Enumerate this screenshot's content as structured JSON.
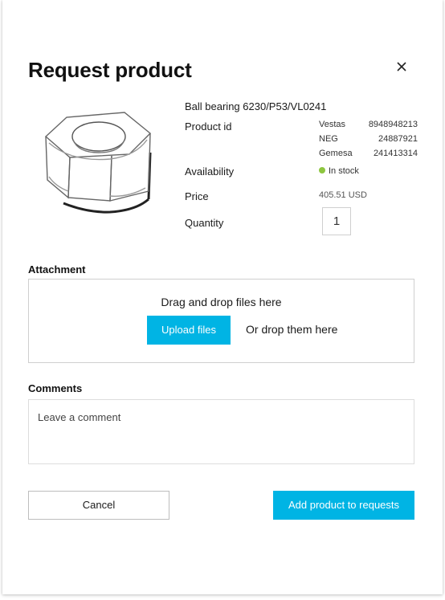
{
  "dialog": {
    "title": "Request product",
    "close_icon": "close-icon"
  },
  "product": {
    "image_icon": "hex-nut-icon",
    "name": "Ball bearing 6230/P53/VL0241",
    "product_id_label": "Product id",
    "product_ids": [
      {
        "supplier": "Vestas",
        "id": "8948948213"
      },
      {
        "supplier": "NEG",
        "id": "24887921"
      },
      {
        "supplier": "Gemesa",
        "id": "241413314"
      }
    ],
    "availability_label": "Availability",
    "availability_value": "In stock",
    "availability_color": "#8dc63f",
    "price_label": "Price",
    "price_value": "405.51 USD",
    "quantity_label": "Quantity",
    "quantity_value": "1"
  },
  "attachment": {
    "label": "Attachment",
    "drop_text": "Drag and drop files here",
    "upload_button": "Upload files",
    "alt_text": "Or drop them here"
  },
  "comments": {
    "label": "Comments",
    "placeholder": "Leave a comment"
  },
  "actions": {
    "cancel": "Cancel",
    "submit": "Add product to requests"
  },
  "colors": {
    "accent": "#00b4e4",
    "in_stock": "#8dc63f"
  }
}
